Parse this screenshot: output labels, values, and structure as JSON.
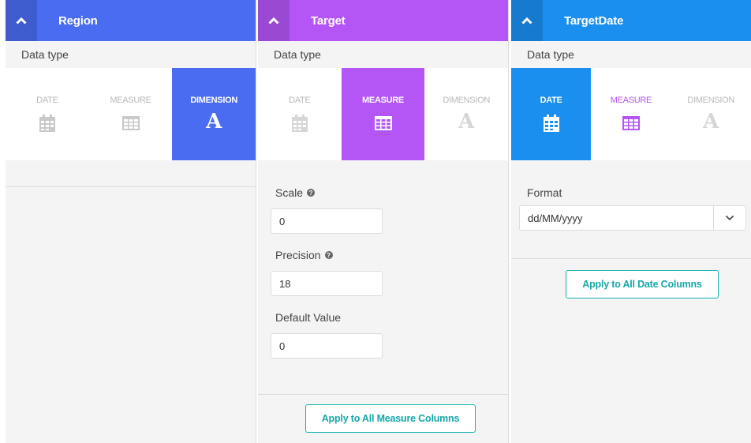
{
  "colors": {
    "region": "#4a6cf0",
    "target": "#b455f5",
    "target_date": "#1a8ff0",
    "toggle_dark_overlay": "rgba(0,0,0,0.14)",
    "teal_button": "#17a7a9"
  },
  "common": {
    "data_type_label": "Data type",
    "types": {
      "date": "DATE",
      "measure": "MEASURE",
      "dimension": "DIMENSION"
    }
  },
  "panels": [
    {
      "title": "Region",
      "selected_type": "DIMENSION",
      "icons": {
        "date": "calendar-icon",
        "measure": "table-grid-icon",
        "dimension": "letter-a-icon"
      }
    },
    {
      "title": "Target",
      "selected_type": "MEASURE",
      "fields": {
        "scale": {
          "label": "Scale",
          "value": "0"
        },
        "precision": {
          "label": "Precision",
          "value": "18"
        },
        "default_value": {
          "label": "Default Value",
          "value": "0"
        }
      },
      "apply_label": "Apply to All Measure Columns"
    },
    {
      "title": "TargetDate",
      "selected_type": "DATE",
      "format": {
        "label": "Format",
        "value": "dd/MM/yyyy"
      },
      "apply_label": "Apply to All Date Columns"
    }
  ]
}
